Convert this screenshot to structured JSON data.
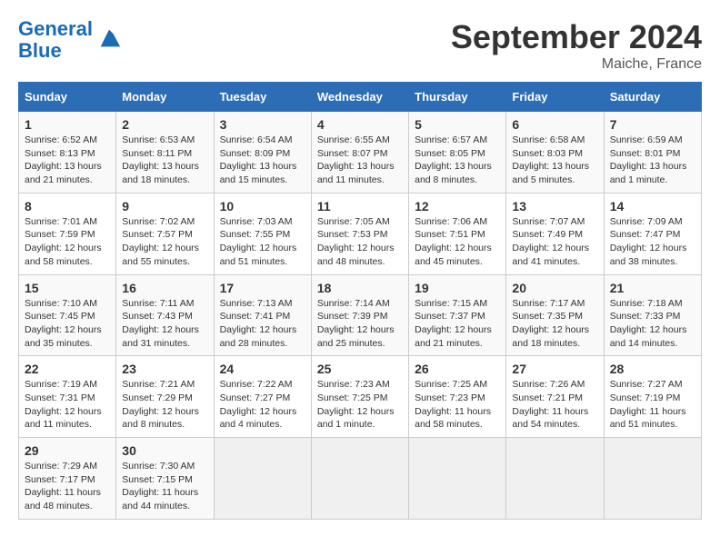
{
  "header": {
    "logo_line1": "General",
    "logo_line2": "Blue",
    "month_year": "September 2024",
    "location": "Maiche, France"
  },
  "weekdays": [
    "Sunday",
    "Monday",
    "Tuesday",
    "Wednesday",
    "Thursday",
    "Friday",
    "Saturday"
  ],
  "weeks": [
    [
      {
        "day": "1",
        "info": "Sunrise: 6:52 AM\nSunset: 8:13 PM\nDaylight: 13 hours\nand 21 minutes."
      },
      {
        "day": "2",
        "info": "Sunrise: 6:53 AM\nSunset: 8:11 PM\nDaylight: 13 hours\nand 18 minutes."
      },
      {
        "day": "3",
        "info": "Sunrise: 6:54 AM\nSunset: 8:09 PM\nDaylight: 13 hours\nand 15 minutes."
      },
      {
        "day": "4",
        "info": "Sunrise: 6:55 AM\nSunset: 8:07 PM\nDaylight: 13 hours\nand 11 minutes."
      },
      {
        "day": "5",
        "info": "Sunrise: 6:57 AM\nSunset: 8:05 PM\nDaylight: 13 hours\nand 8 minutes."
      },
      {
        "day": "6",
        "info": "Sunrise: 6:58 AM\nSunset: 8:03 PM\nDaylight: 13 hours\nand 5 minutes."
      },
      {
        "day": "7",
        "info": "Sunrise: 6:59 AM\nSunset: 8:01 PM\nDaylight: 13 hours\nand 1 minute."
      }
    ],
    [
      {
        "day": "8",
        "info": "Sunrise: 7:01 AM\nSunset: 7:59 PM\nDaylight: 12 hours\nand 58 minutes."
      },
      {
        "day": "9",
        "info": "Sunrise: 7:02 AM\nSunset: 7:57 PM\nDaylight: 12 hours\nand 55 minutes."
      },
      {
        "day": "10",
        "info": "Sunrise: 7:03 AM\nSunset: 7:55 PM\nDaylight: 12 hours\nand 51 minutes."
      },
      {
        "day": "11",
        "info": "Sunrise: 7:05 AM\nSunset: 7:53 PM\nDaylight: 12 hours\nand 48 minutes."
      },
      {
        "day": "12",
        "info": "Sunrise: 7:06 AM\nSunset: 7:51 PM\nDaylight: 12 hours\nand 45 minutes."
      },
      {
        "day": "13",
        "info": "Sunrise: 7:07 AM\nSunset: 7:49 PM\nDaylight: 12 hours\nand 41 minutes."
      },
      {
        "day": "14",
        "info": "Sunrise: 7:09 AM\nSunset: 7:47 PM\nDaylight: 12 hours\nand 38 minutes."
      }
    ],
    [
      {
        "day": "15",
        "info": "Sunrise: 7:10 AM\nSunset: 7:45 PM\nDaylight: 12 hours\nand 35 minutes."
      },
      {
        "day": "16",
        "info": "Sunrise: 7:11 AM\nSunset: 7:43 PM\nDaylight: 12 hours\nand 31 minutes."
      },
      {
        "day": "17",
        "info": "Sunrise: 7:13 AM\nSunset: 7:41 PM\nDaylight: 12 hours\nand 28 minutes."
      },
      {
        "day": "18",
        "info": "Sunrise: 7:14 AM\nSunset: 7:39 PM\nDaylight: 12 hours\nand 25 minutes."
      },
      {
        "day": "19",
        "info": "Sunrise: 7:15 AM\nSunset: 7:37 PM\nDaylight: 12 hours\nand 21 minutes."
      },
      {
        "day": "20",
        "info": "Sunrise: 7:17 AM\nSunset: 7:35 PM\nDaylight: 12 hours\nand 18 minutes."
      },
      {
        "day": "21",
        "info": "Sunrise: 7:18 AM\nSunset: 7:33 PM\nDaylight: 12 hours\nand 14 minutes."
      }
    ],
    [
      {
        "day": "22",
        "info": "Sunrise: 7:19 AM\nSunset: 7:31 PM\nDaylight: 12 hours\nand 11 minutes."
      },
      {
        "day": "23",
        "info": "Sunrise: 7:21 AM\nSunset: 7:29 PM\nDaylight: 12 hours\nand 8 minutes."
      },
      {
        "day": "24",
        "info": "Sunrise: 7:22 AM\nSunset: 7:27 PM\nDaylight: 12 hours\nand 4 minutes."
      },
      {
        "day": "25",
        "info": "Sunrise: 7:23 AM\nSunset: 7:25 PM\nDaylight: 12 hours\nand 1 minute."
      },
      {
        "day": "26",
        "info": "Sunrise: 7:25 AM\nSunset: 7:23 PM\nDaylight: 11 hours\nand 58 minutes."
      },
      {
        "day": "27",
        "info": "Sunrise: 7:26 AM\nSunset: 7:21 PM\nDaylight: 11 hours\nand 54 minutes."
      },
      {
        "day": "28",
        "info": "Sunrise: 7:27 AM\nSunset: 7:19 PM\nDaylight: 11 hours\nand 51 minutes."
      }
    ],
    [
      {
        "day": "29",
        "info": "Sunrise: 7:29 AM\nSunset: 7:17 PM\nDaylight: 11 hours\nand 48 minutes."
      },
      {
        "day": "30",
        "info": "Sunrise: 7:30 AM\nSunset: 7:15 PM\nDaylight: 11 hours\nand 44 minutes."
      },
      {
        "day": "",
        "info": ""
      },
      {
        "day": "",
        "info": ""
      },
      {
        "day": "",
        "info": ""
      },
      {
        "day": "",
        "info": ""
      },
      {
        "day": "",
        "info": ""
      }
    ]
  ]
}
